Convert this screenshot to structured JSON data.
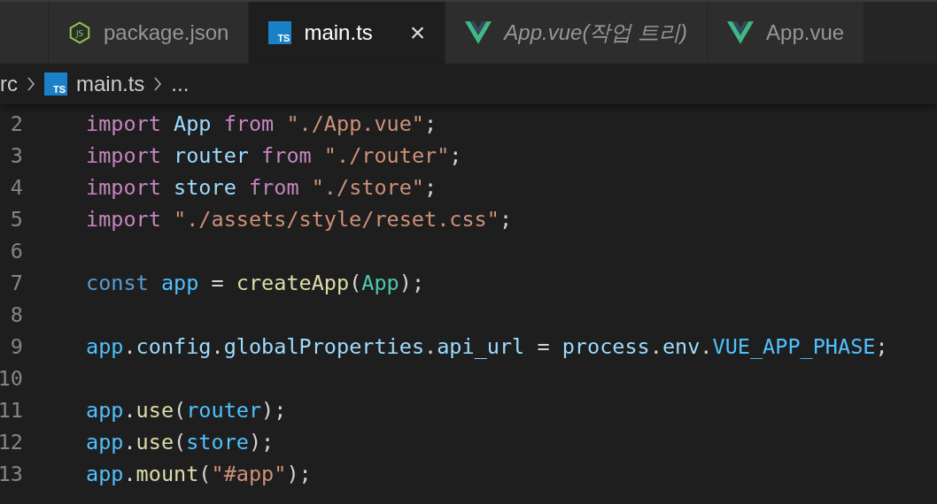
{
  "tabs": [
    {
      "label": "package.json",
      "kind": "javascript",
      "icon_label": "JS",
      "selected": false,
      "italic": false
    },
    {
      "label": "main.ts",
      "kind": "typescript",
      "icon_label": "TS",
      "selected": true,
      "italic": false,
      "close": "×"
    },
    {
      "label": "App.vue(작업 트리)",
      "kind": "vue",
      "selected": false,
      "italic": true
    },
    {
      "label": "App.vue",
      "kind": "vue",
      "selected": false,
      "italic": false
    }
  ],
  "breadcrumb": {
    "folder": "rc",
    "file": "main.ts",
    "icon_label": "TS",
    "more": "..."
  },
  "lines": [
    {
      "number": "2",
      "tokens": [
        {
          "kind": "keyword",
          "text": "import "
        },
        {
          "kind": "variable",
          "text": "App "
        },
        {
          "kind": "keyword",
          "text": "from "
        },
        {
          "kind": "string",
          "text": "\"./App.vue\""
        },
        {
          "kind": "plain",
          "text": ";"
        }
      ]
    },
    {
      "number": "3",
      "tokens": [
        {
          "kind": "keyword",
          "text": "import "
        },
        {
          "kind": "variable",
          "text": "router "
        },
        {
          "kind": "keyword",
          "text": "from "
        },
        {
          "kind": "string",
          "text": "\"./router\""
        },
        {
          "kind": "plain",
          "text": ";"
        }
      ]
    },
    {
      "number": "4",
      "tokens": [
        {
          "kind": "keyword",
          "text": "import "
        },
        {
          "kind": "variable",
          "text": "store "
        },
        {
          "kind": "keyword",
          "text": "from "
        },
        {
          "kind": "string",
          "text": "\"./store\""
        },
        {
          "kind": "plain",
          "text": ";"
        }
      ]
    },
    {
      "number": "5",
      "tokens": [
        {
          "kind": "keyword",
          "text": "import "
        },
        {
          "kind": "string",
          "text": "\"./assets/style/reset.css\""
        },
        {
          "kind": "plain",
          "text": ";"
        }
      ]
    },
    {
      "number": "6"
    },
    {
      "number": "7",
      "tokens": [
        {
          "kind": "storage",
          "text": "const "
        },
        {
          "kind": "constant",
          "text": "app"
        },
        {
          "kind": "plain",
          "text": " = "
        },
        {
          "kind": "function",
          "text": "createApp"
        },
        {
          "kind": "plain",
          "text": "("
        },
        {
          "kind": "class",
          "text": "App"
        },
        {
          "kind": "plain",
          "text": ");"
        }
      ]
    },
    {
      "number": "8"
    },
    {
      "number": "9",
      "tokens": [
        {
          "kind": "constant",
          "text": "app"
        },
        {
          "kind": "plain",
          "text": "."
        },
        {
          "kind": "variable",
          "text": "config"
        },
        {
          "kind": "plain",
          "text": "."
        },
        {
          "kind": "variable",
          "text": "globalProperties"
        },
        {
          "kind": "plain",
          "text": "."
        },
        {
          "kind": "variable",
          "text": "api_url"
        },
        {
          "kind": "plain",
          "text": " = "
        },
        {
          "kind": "variable",
          "text": "process"
        },
        {
          "kind": "plain",
          "text": "."
        },
        {
          "kind": "variable",
          "text": "env"
        },
        {
          "kind": "plain",
          "text": "."
        },
        {
          "kind": "constant",
          "text": "VUE_APP_PHASE"
        },
        {
          "kind": "plain",
          "text": ";"
        }
      ]
    },
    {
      "number": "10"
    },
    {
      "number": "11",
      "tokens": [
        {
          "kind": "constant",
          "text": "app"
        },
        {
          "kind": "plain",
          "text": "."
        },
        {
          "kind": "function",
          "text": "use"
        },
        {
          "kind": "plain",
          "text": "("
        },
        {
          "kind": "constant",
          "text": "router"
        },
        {
          "kind": "plain",
          "text": ");"
        }
      ]
    },
    {
      "number": "12",
      "tokens": [
        {
          "kind": "constant",
          "text": "app"
        },
        {
          "kind": "plain",
          "text": "."
        },
        {
          "kind": "function",
          "text": "use"
        },
        {
          "kind": "plain",
          "text": "("
        },
        {
          "kind": "constant",
          "text": "store"
        },
        {
          "kind": "plain",
          "text": ");"
        }
      ]
    },
    {
      "number": "13",
      "tokens": [
        {
          "kind": "constant",
          "text": "app"
        },
        {
          "kind": "plain",
          "text": "."
        },
        {
          "kind": "function",
          "text": "mount"
        },
        {
          "kind": "plain",
          "text": "("
        },
        {
          "kind": "string",
          "text": "\"#app\""
        },
        {
          "kind": "plain",
          "text": ");"
        }
      ]
    }
  ]
}
